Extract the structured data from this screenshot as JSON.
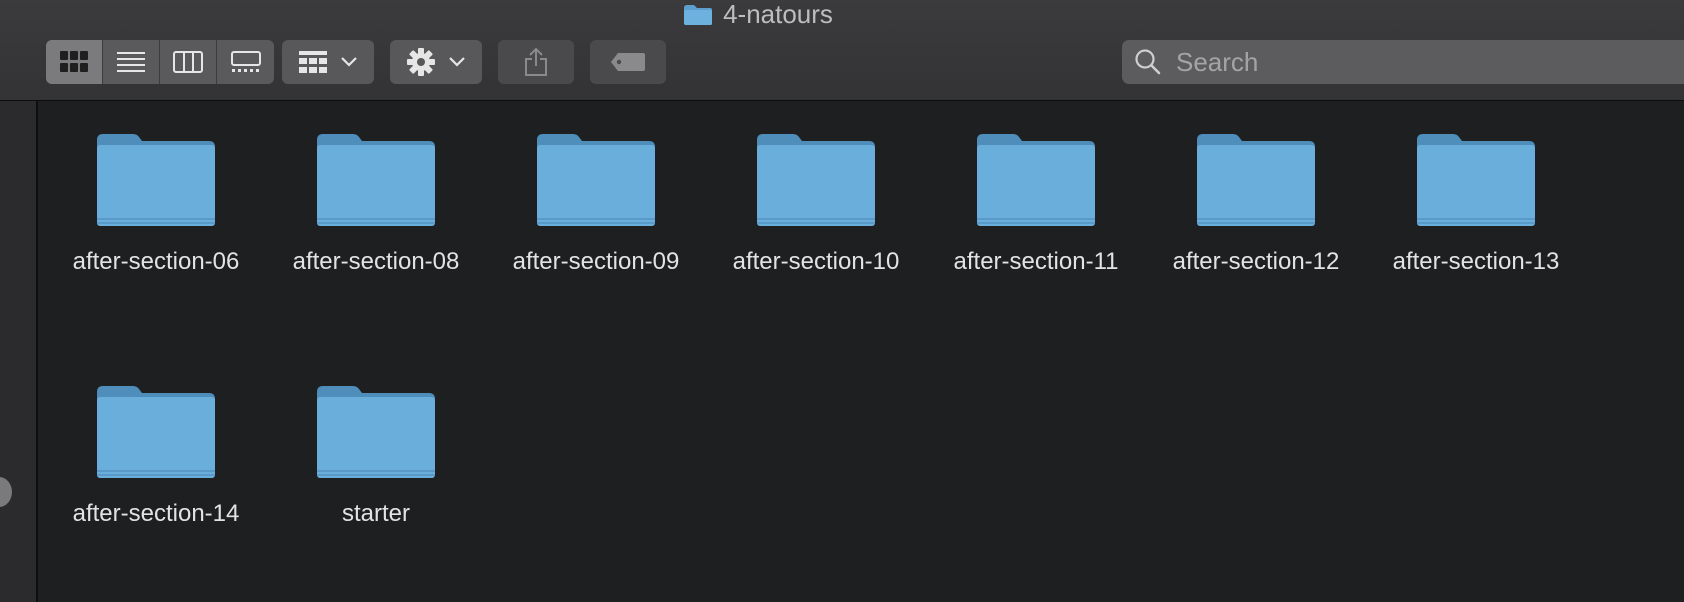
{
  "window": {
    "title": "4-natours"
  },
  "toolbar": {
    "view_modes": [
      "icon-view",
      "list-view",
      "column-view",
      "gallery-view"
    ],
    "active_view": "icon-view",
    "search_placeholder": "Search"
  },
  "items": [
    {
      "name": "after-section-06"
    },
    {
      "name": "after-section-08"
    },
    {
      "name": "after-section-09"
    },
    {
      "name": "after-section-10"
    },
    {
      "name": "after-section-11"
    },
    {
      "name": "after-section-12"
    },
    {
      "name": "after-section-13"
    },
    {
      "name": "after-section-14"
    },
    {
      "name": "starter"
    }
  ],
  "colors": {
    "folder_body": "#6aaedb",
    "folder_tab": "#4f8dba",
    "accent": "#1e1f21"
  }
}
